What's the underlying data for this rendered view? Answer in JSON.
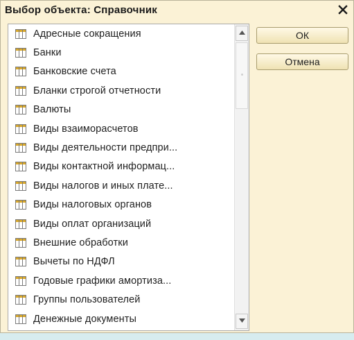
{
  "window": {
    "title": "Выбор объекта: Справочник"
  },
  "list": {
    "icon": "catalog-table-icon",
    "items": [
      {
        "label": "Адресные сокращения"
      },
      {
        "label": "Банки"
      },
      {
        "label": "Банковские счета"
      },
      {
        "label": "Бланки строгой отчетности"
      },
      {
        "label": "Валюты"
      },
      {
        "label": "Виды взаиморасчетов"
      },
      {
        "label": "Виды деятельности предпри..."
      },
      {
        "label": "Виды контактной информац..."
      },
      {
        "label": "Виды налогов и иных плате..."
      },
      {
        "label": "Виды налоговых органов"
      },
      {
        "label": "Виды оплат организаций"
      },
      {
        "label": "Внешние обработки"
      },
      {
        "label": "Вычеты по НДФЛ"
      },
      {
        "label": "Годовые графики амортиза..."
      },
      {
        "label": "Группы пользователей"
      },
      {
        "label": "Денежные документы"
      }
    ]
  },
  "buttons": {
    "ok_label": "ОК",
    "cancel_label": "Отмена"
  },
  "colors": {
    "dialog_background": "#fbf2d6",
    "icon_accent": "#d9a82a",
    "icon_border": "#7a7a7a"
  }
}
